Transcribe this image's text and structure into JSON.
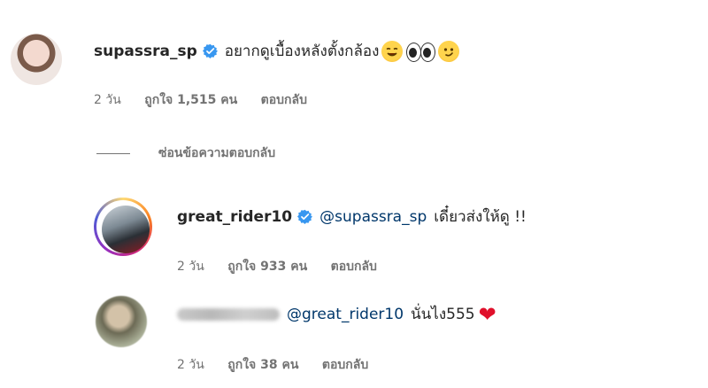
{
  "comments": [
    {
      "username": "supassra_sp",
      "text": "อยากดูเบื้องหลังตั้งกล้อง",
      "emojis": [
        "grinning-smirk-emoji",
        "eyes-emoji",
        "smirk-emoji"
      ],
      "time": "2 วัน",
      "likes": "ถูกใจ 1,515 คน",
      "reply": "ตอบกลับ"
    }
  ],
  "hide_replies_label": "ซ่อนข้อความตอบกลับ",
  "replies": [
    {
      "username": "great_rider10",
      "mention": "@supassra_sp",
      "text": "เดี๋ยวส่งให้ดู !!",
      "time": "2 วัน",
      "likes": "ถูกใจ 933 คน",
      "reply": "ตอบกลับ"
    },
    {
      "mention": "@great_rider10",
      "text": "นั่นไง555",
      "emoji": "red-heart-emoji",
      "time": "2 วัน",
      "likes": "ถูกใจ 38 คน",
      "reply": "ตอบกลับ"
    }
  ],
  "colors": {
    "verified": "#3897f0",
    "mention": "#00376b",
    "meta": "#737373",
    "heart": "#e0102b"
  }
}
